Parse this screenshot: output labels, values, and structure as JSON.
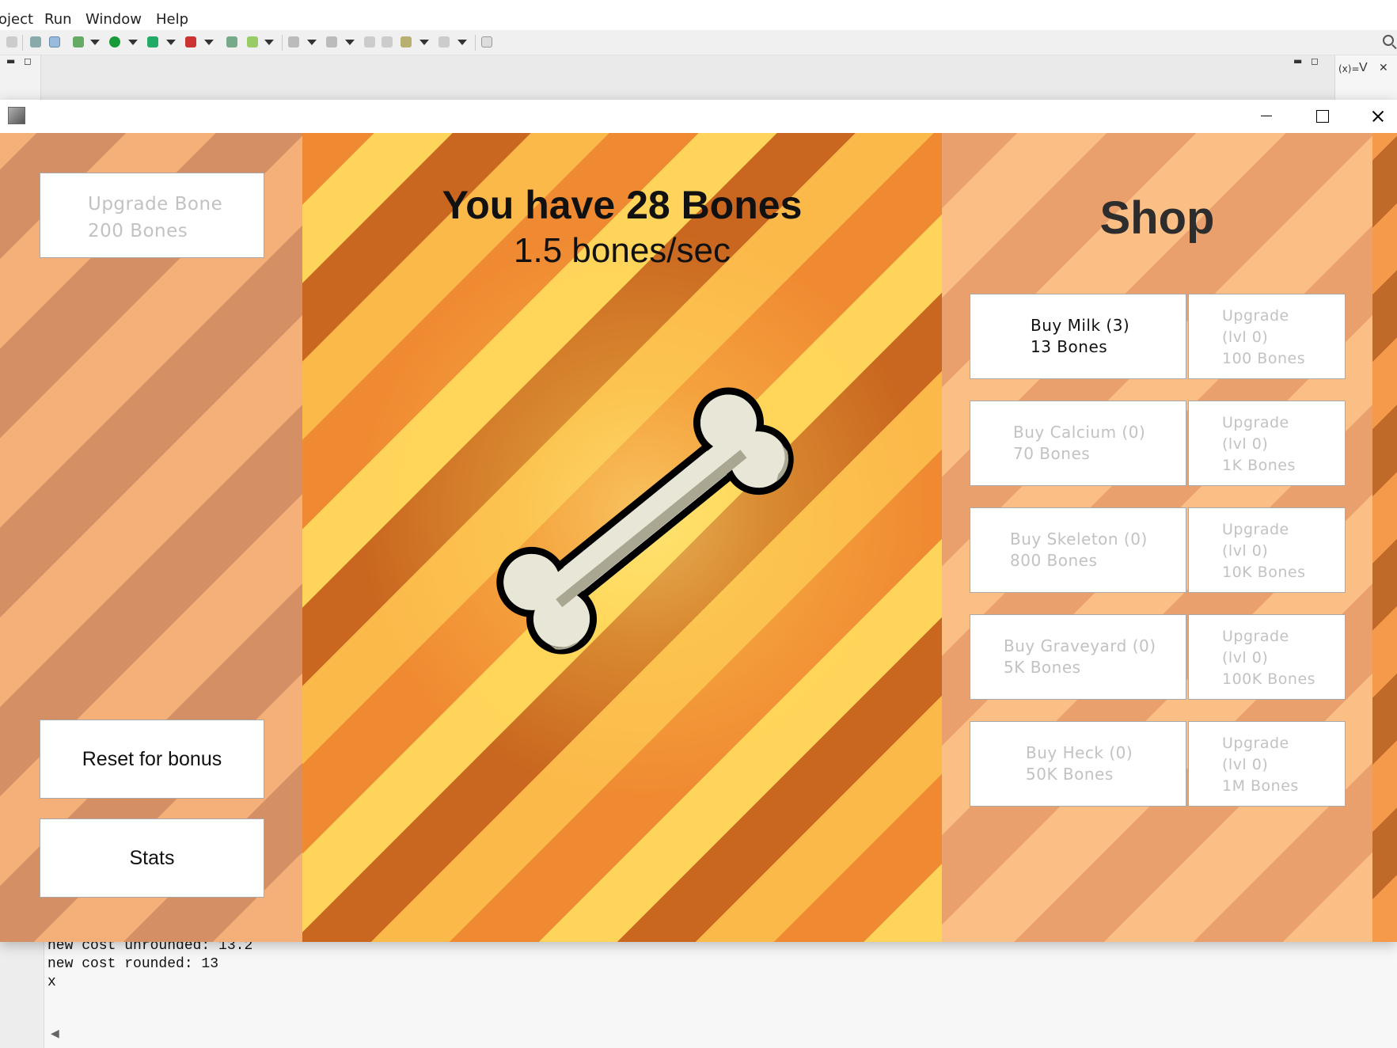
{
  "ide": {
    "menu": [
      "oject",
      "Run",
      "Window",
      "Help"
    ],
    "view_tab_label": "V",
    "console_lines": [
      "new cost unrounded: 13.2",
      "new cost rounded: 13",
      "x"
    ]
  },
  "game": {
    "bones_count": "You have 28 Bones",
    "bones_rate": "1.5 bones/sec",
    "shop_title": "Shop",
    "upgrade_bone": {
      "line1": "Upgrade Bone",
      "line2": "200 Bones",
      "enabled": false
    },
    "reset_label": "Reset for bonus",
    "stats_label": "Stats",
    "shop_items": [
      {
        "buy1": "Buy Milk (3)",
        "buy2": "13 Bones",
        "buy_enabled": true,
        "upg1": "Upgrade",
        "upg2": "(lvl 0)",
        "upg3": "100 Bones"
      },
      {
        "buy1": "Buy Calcium (0)",
        "buy2": "70 Bones",
        "buy_enabled": false,
        "upg1": "Upgrade",
        "upg2": "(lvl 0)",
        "upg3": "1K Bones"
      },
      {
        "buy1": "Buy Skeleton (0)",
        "buy2": "800 Bones",
        "buy_enabled": false,
        "upg1": "Upgrade",
        "upg2": "(lvl 0)",
        "upg3": "10K Bones"
      },
      {
        "buy1": "Buy Graveyard (0)",
        "buy2": "5K Bones",
        "buy_enabled": false,
        "upg1": "Upgrade",
        "upg2": "(lvl 0)",
        "upg3": "100K Bones"
      },
      {
        "buy1": "Buy Heck (0)",
        "buy2": "50K Bones",
        "buy_enabled": false,
        "upg1": "Upgrade",
        "upg2": "(lvl 0)",
        "upg3": "1M Bones"
      }
    ]
  },
  "colors": {
    "text_enabled": "#111111",
    "text_disabled": "#c2c2c2",
    "stripe_yellow": "#ffd45a",
    "stripe_orange": "#f08a32",
    "bone_fill": "#e8e6d6",
    "bone_shade": "#a9a691"
  }
}
